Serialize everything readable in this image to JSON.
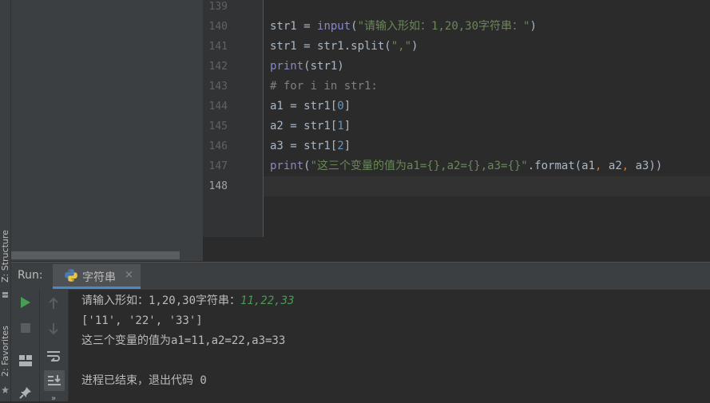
{
  "left_strip": {
    "structure_label": "Z: Structure",
    "favorites_label": "2: Favorites"
  },
  "editor": {
    "line_numbers": [
      "139",
      "140",
      "141",
      "142",
      "143",
      "144",
      "145",
      "146",
      "147",
      "148"
    ],
    "lines": [
      {
        "tokens": []
      },
      {
        "tokens": [
          {
            "t": "str1 = ",
            "c": ""
          },
          {
            "t": "input",
            "c": "kw"
          },
          {
            "t": "(",
            "c": ""
          },
          {
            "t": "\"请输入形如：1,20,30字符串：\"",
            "c": "str"
          },
          {
            "t": ")",
            "c": ""
          }
        ]
      },
      {
        "tokens": [
          {
            "t": "str1 = str1.split(",
            "c": ""
          },
          {
            "t": "\",\"",
            "c": "str"
          },
          {
            "t": ")",
            "c": ""
          }
        ]
      },
      {
        "tokens": [
          {
            "t": "print",
            "c": "kw"
          },
          {
            "t": "(str1)",
            "c": ""
          }
        ]
      },
      {
        "tokens": [
          {
            "t": "# for i in str1:",
            "c": "cmt"
          }
        ]
      },
      {
        "tokens": [
          {
            "t": "a1 = str1[",
            "c": ""
          },
          {
            "t": "0",
            "c": "num"
          },
          {
            "t": "]",
            "c": ""
          }
        ]
      },
      {
        "tokens": [
          {
            "t": "a2 = str1[",
            "c": ""
          },
          {
            "t": "1",
            "c": "num"
          },
          {
            "t": "]",
            "c": ""
          }
        ]
      },
      {
        "tokens": [
          {
            "t": "a3 = str1[",
            "c": ""
          },
          {
            "t": "2",
            "c": "num"
          },
          {
            "t": "]",
            "c": ""
          }
        ]
      },
      {
        "tokens": [
          {
            "t": "print",
            "c": "kw"
          },
          {
            "t": "(",
            "c": ""
          },
          {
            "t": "\"这三个变量的值为a1={},a2={},a3={}\"",
            "c": "str"
          },
          {
            "t": ".format(a1",
            "c": ""
          },
          {
            "t": ", ",
            "c": "op"
          },
          {
            "t": "a2",
            "c": ""
          },
          {
            "t": ", ",
            "c": "op"
          },
          {
            "t": "a3))",
            "c": ""
          }
        ]
      },
      {
        "tokens": []
      }
    ]
  },
  "run_panel": {
    "label": "Run:",
    "tab_label": "字符串",
    "tab_close": "×"
  },
  "console": {
    "prompt": "请输入形如：1,20,30字符串：",
    "user_input": "11,22,33",
    "line2": "['11', '22', '33']",
    "line3": "这三个变量的值为a1=11,a2=22,a3=33",
    "line4": "",
    "exit_message": "进程已结束，退出代码 0"
  },
  "colors": {
    "accent": "#4a88c7",
    "run_green": "#499c54",
    "keyword": "#8888c6",
    "string": "#6a8759"
  }
}
